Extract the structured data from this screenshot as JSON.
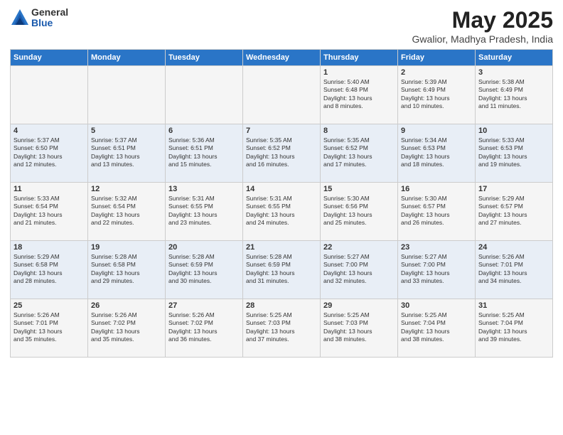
{
  "logo": {
    "general": "General",
    "blue": "Blue"
  },
  "title": "May 2025",
  "subtitle": "Gwalior, Madhya Pradesh, India",
  "weekdays": [
    "Sunday",
    "Monday",
    "Tuesday",
    "Wednesday",
    "Thursday",
    "Friday",
    "Saturday"
  ],
  "weeks": [
    [
      {
        "day": "",
        "info": ""
      },
      {
        "day": "",
        "info": ""
      },
      {
        "day": "",
        "info": ""
      },
      {
        "day": "",
        "info": ""
      },
      {
        "day": "1",
        "info": "Sunrise: 5:40 AM\nSunset: 6:48 PM\nDaylight: 13 hours\nand 8 minutes."
      },
      {
        "day": "2",
        "info": "Sunrise: 5:39 AM\nSunset: 6:49 PM\nDaylight: 13 hours\nand 10 minutes."
      },
      {
        "day": "3",
        "info": "Sunrise: 5:38 AM\nSunset: 6:49 PM\nDaylight: 13 hours\nand 11 minutes."
      }
    ],
    [
      {
        "day": "4",
        "info": "Sunrise: 5:37 AM\nSunset: 6:50 PM\nDaylight: 13 hours\nand 12 minutes."
      },
      {
        "day": "5",
        "info": "Sunrise: 5:37 AM\nSunset: 6:51 PM\nDaylight: 13 hours\nand 13 minutes."
      },
      {
        "day": "6",
        "info": "Sunrise: 5:36 AM\nSunset: 6:51 PM\nDaylight: 13 hours\nand 15 minutes."
      },
      {
        "day": "7",
        "info": "Sunrise: 5:35 AM\nSunset: 6:52 PM\nDaylight: 13 hours\nand 16 minutes."
      },
      {
        "day": "8",
        "info": "Sunrise: 5:35 AM\nSunset: 6:52 PM\nDaylight: 13 hours\nand 17 minutes."
      },
      {
        "day": "9",
        "info": "Sunrise: 5:34 AM\nSunset: 6:53 PM\nDaylight: 13 hours\nand 18 minutes."
      },
      {
        "day": "10",
        "info": "Sunrise: 5:33 AM\nSunset: 6:53 PM\nDaylight: 13 hours\nand 19 minutes."
      }
    ],
    [
      {
        "day": "11",
        "info": "Sunrise: 5:33 AM\nSunset: 6:54 PM\nDaylight: 13 hours\nand 21 minutes."
      },
      {
        "day": "12",
        "info": "Sunrise: 5:32 AM\nSunset: 6:54 PM\nDaylight: 13 hours\nand 22 minutes."
      },
      {
        "day": "13",
        "info": "Sunrise: 5:31 AM\nSunset: 6:55 PM\nDaylight: 13 hours\nand 23 minutes."
      },
      {
        "day": "14",
        "info": "Sunrise: 5:31 AM\nSunset: 6:55 PM\nDaylight: 13 hours\nand 24 minutes."
      },
      {
        "day": "15",
        "info": "Sunrise: 5:30 AM\nSunset: 6:56 PM\nDaylight: 13 hours\nand 25 minutes."
      },
      {
        "day": "16",
        "info": "Sunrise: 5:30 AM\nSunset: 6:57 PM\nDaylight: 13 hours\nand 26 minutes."
      },
      {
        "day": "17",
        "info": "Sunrise: 5:29 AM\nSunset: 6:57 PM\nDaylight: 13 hours\nand 27 minutes."
      }
    ],
    [
      {
        "day": "18",
        "info": "Sunrise: 5:29 AM\nSunset: 6:58 PM\nDaylight: 13 hours\nand 28 minutes."
      },
      {
        "day": "19",
        "info": "Sunrise: 5:28 AM\nSunset: 6:58 PM\nDaylight: 13 hours\nand 29 minutes."
      },
      {
        "day": "20",
        "info": "Sunrise: 5:28 AM\nSunset: 6:59 PM\nDaylight: 13 hours\nand 30 minutes."
      },
      {
        "day": "21",
        "info": "Sunrise: 5:28 AM\nSunset: 6:59 PM\nDaylight: 13 hours\nand 31 minutes."
      },
      {
        "day": "22",
        "info": "Sunrise: 5:27 AM\nSunset: 7:00 PM\nDaylight: 13 hours\nand 32 minutes."
      },
      {
        "day": "23",
        "info": "Sunrise: 5:27 AM\nSunset: 7:00 PM\nDaylight: 13 hours\nand 33 minutes."
      },
      {
        "day": "24",
        "info": "Sunrise: 5:26 AM\nSunset: 7:01 PM\nDaylight: 13 hours\nand 34 minutes."
      }
    ],
    [
      {
        "day": "25",
        "info": "Sunrise: 5:26 AM\nSunset: 7:01 PM\nDaylight: 13 hours\nand 35 minutes."
      },
      {
        "day": "26",
        "info": "Sunrise: 5:26 AM\nSunset: 7:02 PM\nDaylight: 13 hours\nand 35 minutes."
      },
      {
        "day": "27",
        "info": "Sunrise: 5:26 AM\nSunset: 7:02 PM\nDaylight: 13 hours\nand 36 minutes."
      },
      {
        "day": "28",
        "info": "Sunrise: 5:25 AM\nSunset: 7:03 PM\nDaylight: 13 hours\nand 37 minutes."
      },
      {
        "day": "29",
        "info": "Sunrise: 5:25 AM\nSunset: 7:03 PM\nDaylight: 13 hours\nand 38 minutes."
      },
      {
        "day": "30",
        "info": "Sunrise: 5:25 AM\nSunset: 7:04 PM\nDaylight: 13 hours\nand 38 minutes."
      },
      {
        "day": "31",
        "info": "Sunrise: 5:25 AM\nSunset: 7:04 PM\nDaylight: 13 hours\nand 39 minutes."
      }
    ]
  ]
}
